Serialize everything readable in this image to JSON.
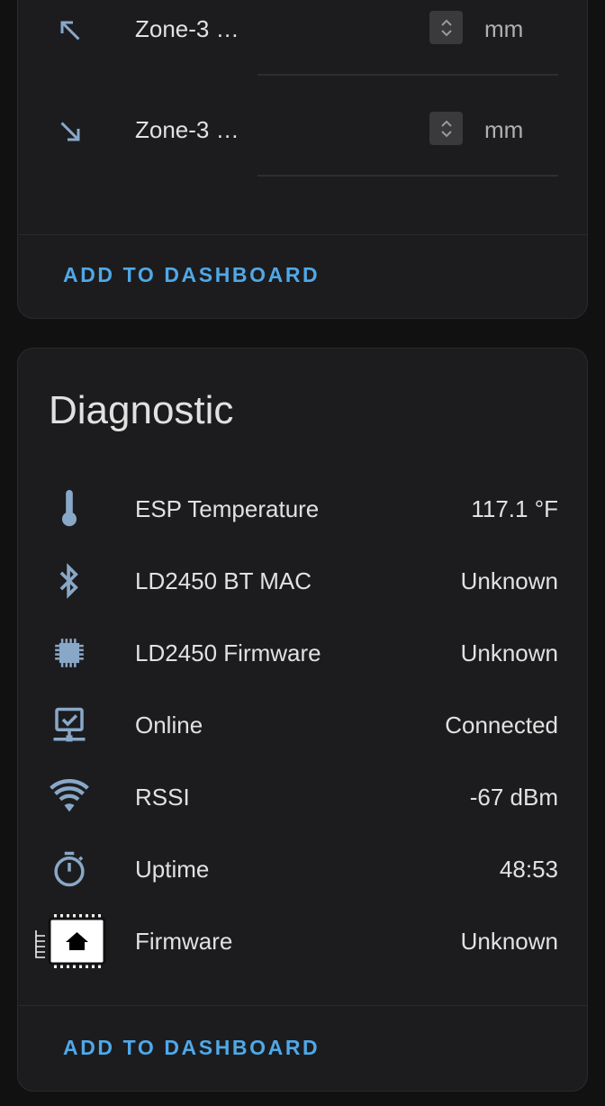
{
  "top_card": {
    "rows": [
      {
        "icon": "arrow-top-left-icon",
        "label": "Zone-3 …",
        "unit": "mm"
      },
      {
        "icon": "arrow-bottom-right-icon",
        "label": "Zone-3 …",
        "unit": "mm"
      }
    ],
    "action_label": "ADD TO DASHBOARD"
  },
  "diagnostic_card": {
    "title": "Diagnostic",
    "rows": [
      {
        "icon": "thermometer-icon",
        "label": "ESP Temperature",
        "value": "117.1 °F"
      },
      {
        "icon": "bluetooth-icon",
        "label": "LD2450 BT MAC",
        "value": "Unknown"
      },
      {
        "icon": "chip-icon",
        "label": "LD2450 Firmware",
        "value": "Unknown"
      },
      {
        "icon": "monitor-network-icon",
        "label": "Online",
        "value": "Connected"
      },
      {
        "icon": "wifi-icon",
        "label": "RSSI",
        "value": "-67 dBm"
      },
      {
        "icon": "timer-icon",
        "label": "Uptime",
        "value": "48:53"
      },
      {
        "icon": "esphome-logo-icon",
        "label": "Firmware",
        "value": "Unknown"
      }
    ],
    "action_label": "ADD TO DASHBOARD"
  },
  "colors": {
    "background": "#111112",
    "card": "#1c1c1e",
    "icon": "#89a8c8",
    "accent": "#4fa8e8",
    "text": "#e1e1e1"
  }
}
